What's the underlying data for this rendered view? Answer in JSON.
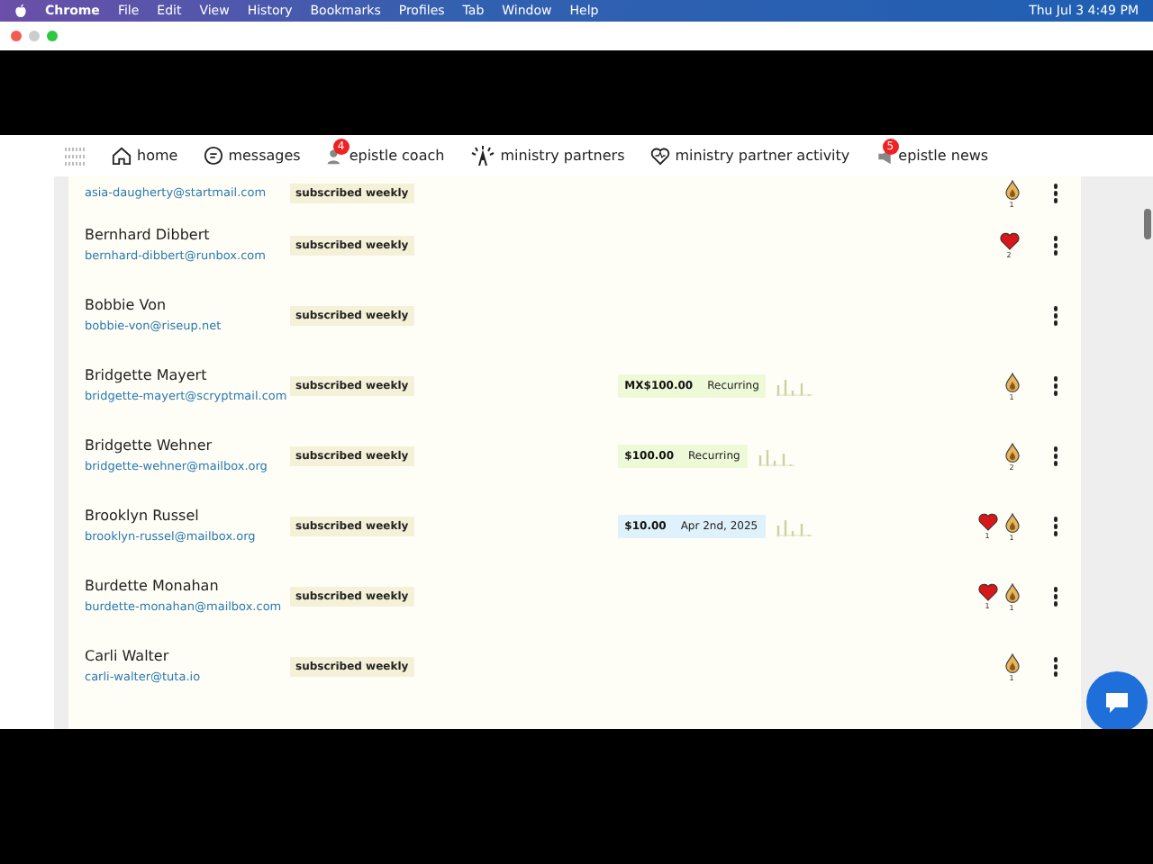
{
  "menu_bar": {
    "app": "Chrome",
    "items": [
      "File",
      "Edit",
      "View",
      "History",
      "Bookmarks",
      "Profiles",
      "Tab",
      "Window",
      "Help"
    ],
    "clock": "Thu Jul 3  4:49 PM"
  },
  "nav": {
    "items": [
      {
        "label": "home"
      },
      {
        "label": "messages"
      },
      {
        "label": "epistle coach",
        "badge": "4"
      },
      {
        "label": "ministry partners"
      },
      {
        "label": "ministry partner activity"
      },
      {
        "label": "epistle news",
        "badge": "5"
      }
    ]
  },
  "partners": [
    {
      "email": "asia-daugherty@startmail.com",
      "subscription": "subscribed weekly",
      "reactions": [
        {
          "kind": "flame",
          "count": "1"
        }
      ]
    },
    {
      "name": "Bernhard Dibbert",
      "email": "bernhard-dibbert@runbox.com",
      "subscription": "subscribed weekly",
      "reactions": [
        {
          "kind": "heart",
          "count": "2"
        }
      ]
    },
    {
      "name": "Bobbie Von",
      "email": "bobbie-von@riseup.net",
      "subscription": "subscribed weekly"
    },
    {
      "name": "Bridgette Mayert",
      "email": "bridgette-mayert@scryptmail.com",
      "subscription": "subscribed weekly",
      "gift": {
        "kind": "recurring",
        "amount": "MX$100.00",
        "detail": "Recurring"
      },
      "reactions": [
        {
          "kind": "flame",
          "count": "1"
        }
      ]
    },
    {
      "name": "Bridgette Wehner",
      "email": "bridgette-wehner@mailbox.org",
      "subscription": "subscribed weekly",
      "gift": {
        "kind": "recurring",
        "amount": "$100.00",
        "detail": "Recurring"
      },
      "reactions": [
        {
          "kind": "flame",
          "count": "2"
        }
      ]
    },
    {
      "name": "Brooklyn Russel",
      "email": "brooklyn-russel@mailbox.org",
      "subscription": "subscribed weekly",
      "gift": {
        "kind": "once",
        "amount": "$10.00",
        "detail": "Apr 2nd, 2025"
      },
      "reactions": [
        {
          "kind": "heart",
          "count": "1"
        },
        {
          "kind": "flame",
          "count": "1"
        }
      ]
    },
    {
      "name": "Burdette Monahan",
      "email": "burdette-monahan@mailbox.com",
      "subscription": "subscribed weekly",
      "reactions": [
        {
          "kind": "heart",
          "count": "1"
        },
        {
          "kind": "flame",
          "count": "1"
        }
      ]
    },
    {
      "name": "Carli Walter",
      "email": "carli-walter@tuta.io",
      "subscription": "subscribed weekly",
      "reactions": [
        {
          "kind": "flame",
          "count": "1"
        }
      ]
    }
  ]
}
